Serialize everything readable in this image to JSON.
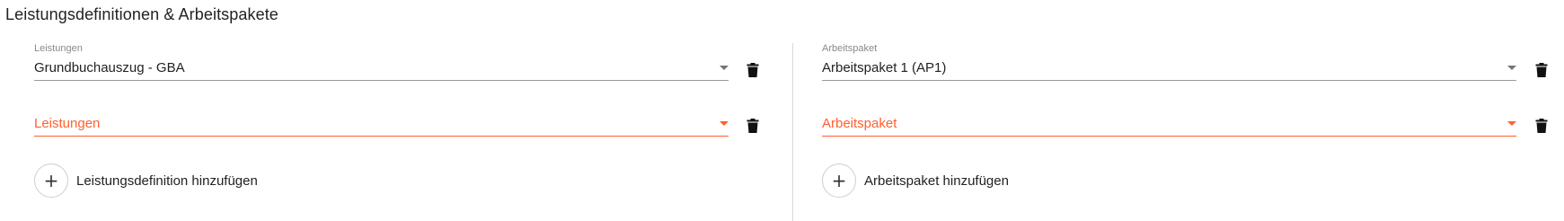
{
  "section": {
    "title": "Leistungsdefinitionen & Arbeitspakete"
  },
  "left": {
    "field1": {
      "label": "Leistungen",
      "value": "Grundbuchauszug - GBA"
    },
    "field2": {
      "placeholder": "Leistungen"
    },
    "add_label": "Leistungsdefinition hinzufügen"
  },
  "right": {
    "field1": {
      "label": "Arbeitspaket",
      "value": "Arbeitspaket 1 (AP1)"
    },
    "field2": {
      "placeholder": "Arbeitspaket"
    },
    "add_label": "Arbeitspaket hinzufügen"
  },
  "icons": {
    "delete": "trash-icon",
    "add": "plus-icon",
    "dropdown": "caret-down-icon"
  },
  "colors": {
    "error": "#ff5f2e",
    "text": "#222222",
    "label": "#8a8a8a"
  },
  "glyphs": {
    "plus": "+"
  }
}
